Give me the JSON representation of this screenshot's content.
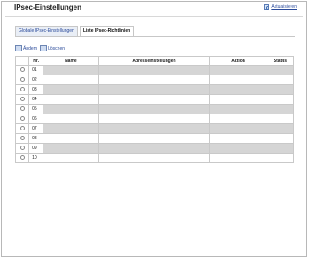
{
  "header": {
    "title": "IPsec-Einstellungen",
    "refresh_label": "Aktualisieren"
  },
  "tabs": [
    {
      "label": "Globale IPsec-Einstellungen",
      "active": false
    },
    {
      "label": "Liste IPsec-Richtlinien",
      "active": true
    }
  ],
  "toolbar": {
    "change_label": "Ändern",
    "delete_label": "Löschen"
  },
  "table": {
    "columns": [
      "",
      "Nr.",
      "Name",
      "Adresseinstellungen",
      "Aktion",
      "Status"
    ],
    "rows": [
      {
        "no": "01",
        "name": "",
        "address": "",
        "action": "",
        "status": ""
      },
      {
        "no": "02",
        "name": "",
        "address": "",
        "action": "",
        "status": ""
      },
      {
        "no": "03",
        "name": "",
        "address": "",
        "action": "",
        "status": ""
      },
      {
        "no": "04",
        "name": "",
        "address": "",
        "action": "",
        "status": ""
      },
      {
        "no": "05",
        "name": "",
        "address": "",
        "action": "",
        "status": ""
      },
      {
        "no": "06",
        "name": "",
        "address": "",
        "action": "",
        "status": ""
      },
      {
        "no": "07",
        "name": "",
        "address": "",
        "action": "",
        "status": ""
      },
      {
        "no": "08",
        "name": "",
        "address": "",
        "action": "",
        "status": ""
      },
      {
        "no": "09",
        "name": "",
        "address": "",
        "action": "",
        "status": ""
      },
      {
        "no": "10",
        "name": "",
        "address": "",
        "action": "",
        "status": ""
      }
    ]
  }
}
